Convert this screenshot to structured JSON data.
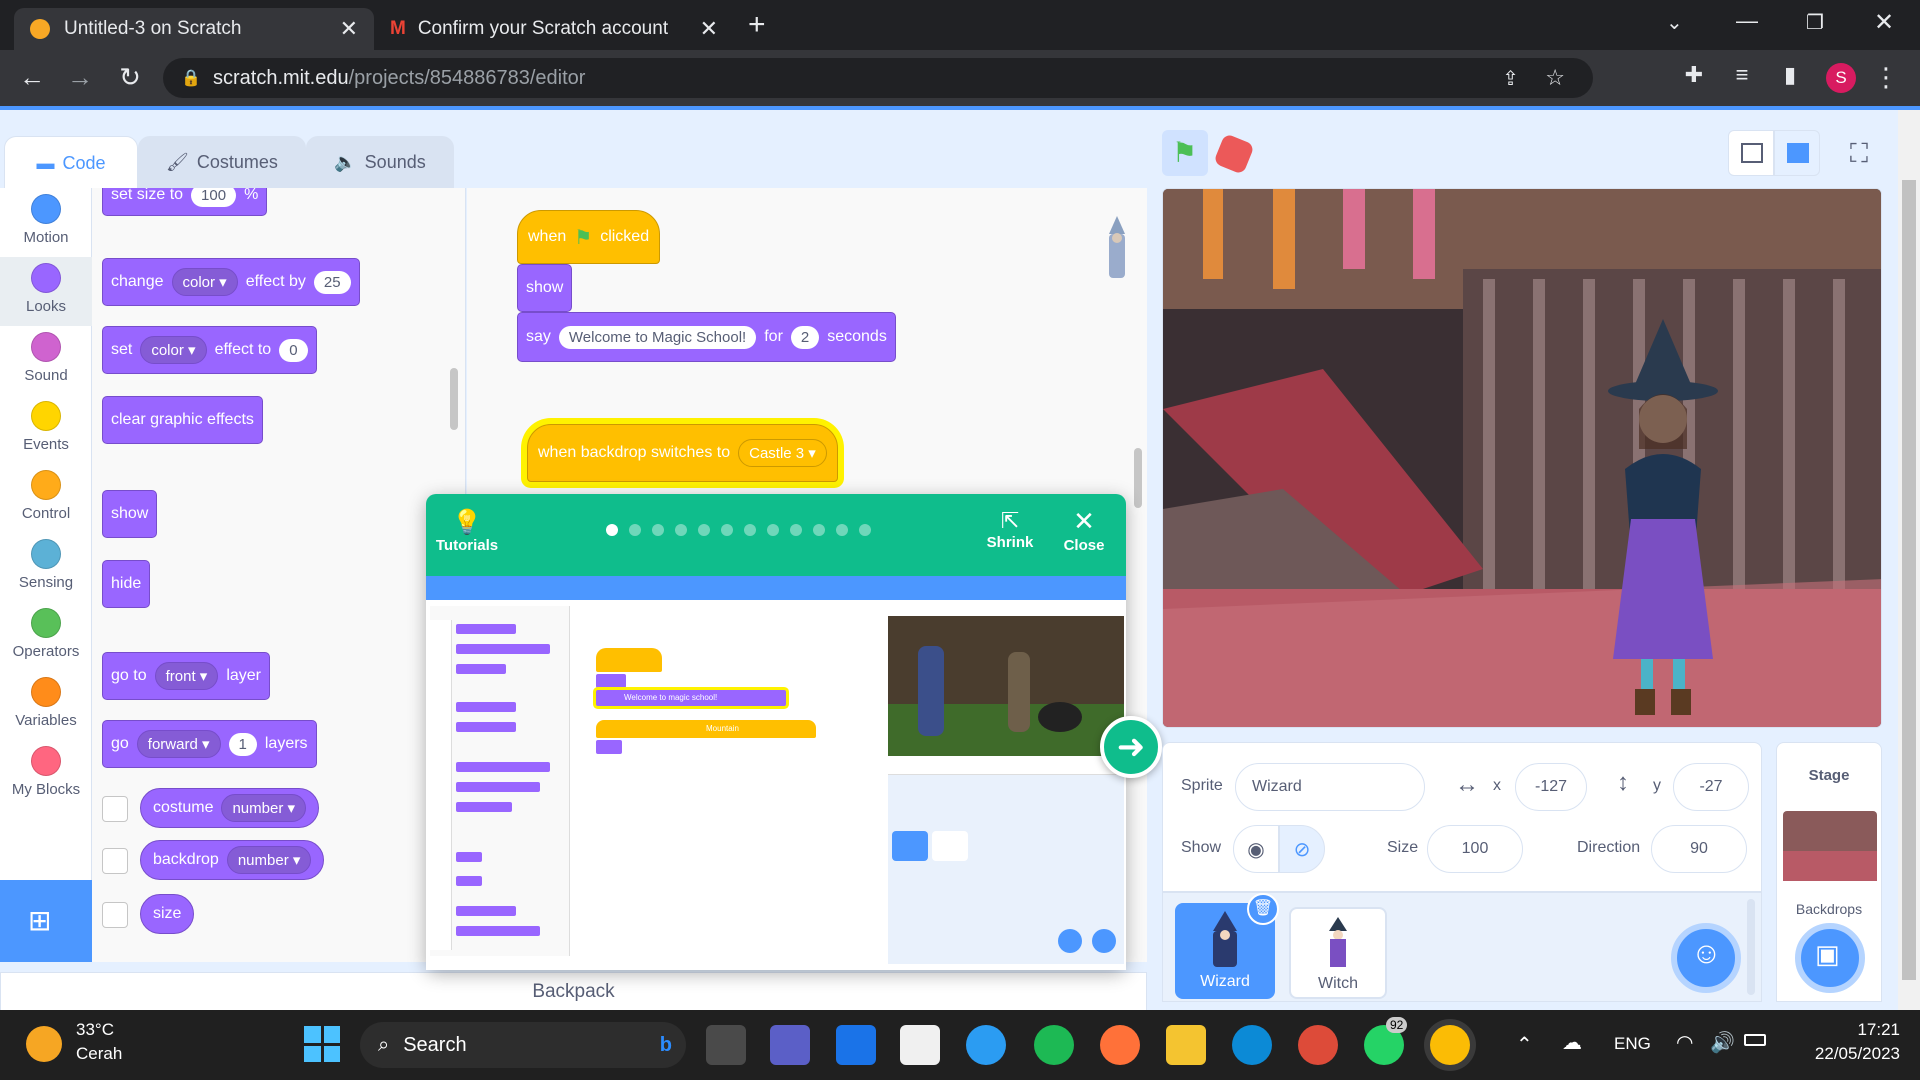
{
  "browser": {
    "tabs": [
      {
        "title": "Untitled-3 on Scratch",
        "close": "✕"
      },
      {
        "title": "Confirm your Scratch account - ",
        "close": "✕"
      }
    ],
    "new_tab": "+",
    "url_host": "scratch.mit.edu",
    "url_path": "/projects/854886783/editor",
    "profile_initial": "S"
  },
  "editor": {
    "tabs": [
      "Code",
      "Costumes",
      "Sounds"
    ],
    "categories": [
      {
        "label": "Motion",
        "color": "#4c97ff"
      },
      {
        "label": "Looks",
        "color": "#9966ff"
      },
      {
        "label": "Sound",
        "color": "#cf63cf"
      },
      {
        "label": "Events",
        "color": "#ffd500"
      },
      {
        "label": "Control",
        "color": "#ffab19"
      },
      {
        "label": "Sensing",
        "color": "#5cb1d6"
      },
      {
        "label": "Operators",
        "color": "#59c059"
      },
      {
        "label": "Variables",
        "color": "#ff8c1a"
      },
      {
        "label": "My Blocks",
        "color": "#ff6680"
      }
    ],
    "palette": {
      "set_size": {
        "a": "set size to",
        "v": "100",
        "b": "%"
      },
      "change_effect": {
        "a": "change",
        "dd": "color",
        "b": "effect by",
        "v": "25"
      },
      "set_effect": {
        "a": "set",
        "dd": "color",
        "b": "effect to",
        "v": "0"
      },
      "clear": "clear graphic effects",
      "show": "show",
      "hide": "hide",
      "goto_layer": {
        "a": "go to",
        "dd": "front",
        "b": "layer"
      },
      "go_layers": {
        "a": "go",
        "dd": "forward",
        "v": "1",
        "b": "layers"
      },
      "costume": {
        "a": "costume",
        "dd": "number"
      },
      "backdrop": {
        "a": "backdrop",
        "dd": "number"
      },
      "size": "size"
    },
    "script": {
      "when": "when",
      "clicked": "clicked",
      "show": "show",
      "say": "say",
      "say_text": "Welcome to Magic School!",
      "for": "for",
      "secs": "2",
      "seconds": "seconds",
      "backdrop_hat": "when backdrop switches to",
      "backdrop_val": "Castle 3"
    },
    "backpack": "Backpack"
  },
  "tutorial": {
    "tutorials_label": "Tutorials",
    "shrink_label": "Shrink",
    "close_label": "Close",
    "mini_say": "Welcome to magic school!",
    "mini_backdrop": "Mountain"
  },
  "sprite_info": {
    "sprite_label": "Sprite",
    "sprite_name": "Wizard",
    "x_label": "x",
    "x": "-127",
    "y_label": "y",
    "y": "-27",
    "show_label": "Show",
    "size_label": "Size",
    "size": "100",
    "direction_label": "Direction",
    "direction": "90"
  },
  "sprites": [
    "Wizard",
    "Witch"
  ],
  "stage_panel": {
    "title": "Stage",
    "backdrops": "Backdrops"
  },
  "taskbar": {
    "weather_temp": "33°C",
    "weather_desc": "Cerah",
    "search": "Search",
    "lang": "ENG",
    "time": "17:21",
    "date": "22/05/2023",
    "badge": "92"
  }
}
